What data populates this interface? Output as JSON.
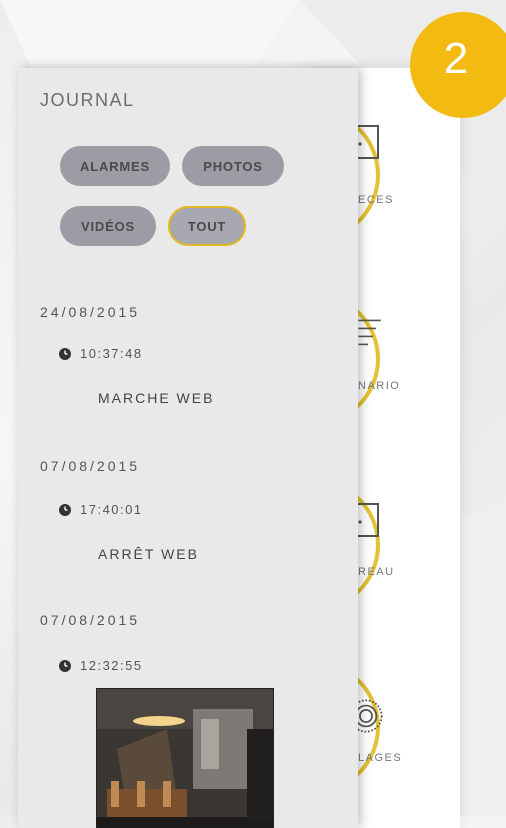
{
  "badge": {
    "number": "2"
  },
  "journal": {
    "title": "JOURNAL",
    "filters": [
      {
        "label": "ALARMES",
        "active": false
      },
      {
        "label": "PHOTOS",
        "active": false
      },
      {
        "label": "VIDÉOS",
        "active": false
      },
      {
        "label": "TOUT",
        "active": true
      }
    ],
    "entries": [
      {
        "date": "24/08/2015",
        "time": "10:37:48",
        "event": "MARCHE WEB"
      },
      {
        "date": "07/08/2015",
        "time": "17:40:01",
        "event": "ARRÊT WEB"
      },
      {
        "date": "07/08/2015",
        "time": "12:32:55",
        "event": ""
      }
    ]
  },
  "menu": {
    "items": [
      {
        "label": "ECES",
        "icon": "door-icon"
      },
      {
        "label": "NARIO",
        "icon": "list-lines-icon"
      },
      {
        "label": "REAU",
        "icon": "door-icon"
      },
      {
        "label": "LAGES",
        "icon": "settings-dial-icon"
      }
    ]
  },
  "colors": {
    "accent_yellow": "#e3c234",
    "badge_orange": "#f3bb12",
    "pill_grey": "#9b9ca4",
    "panel_bg": "#e9e9e9"
  }
}
